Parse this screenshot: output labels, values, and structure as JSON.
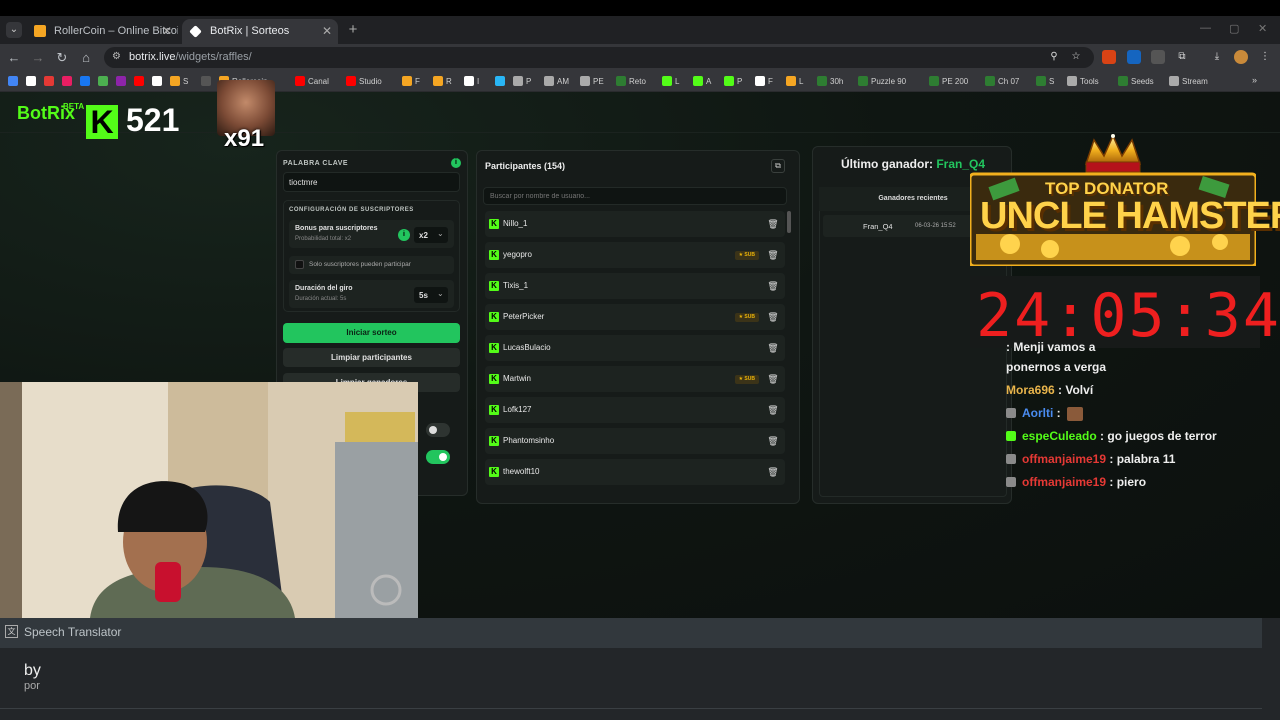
{
  "browser": {
    "tabs": [
      {
        "title": "RollerCoin – Online Bitcoin Mi",
        "active": false,
        "favicon_color": "#f5a623"
      },
      {
        "title": "BotRix | Sorteos",
        "active": true,
        "favicon_color": "#ffffff"
      }
    ],
    "new_tab": "+",
    "url_domain": "botrix.live",
    "url_path": "/widgets/raffles/",
    "bookmarks": [
      {
        "label": "",
        "color": "#4285f4"
      },
      {
        "label": "",
        "color": "#ffffff"
      },
      {
        "label": "",
        "color": "#e53935"
      },
      {
        "label": "",
        "color": "#e91e63"
      },
      {
        "label": "",
        "color": "#1877f2"
      },
      {
        "label": "",
        "color": "#4caf50"
      },
      {
        "label": "",
        "color": "#8e24aa"
      },
      {
        "label": "",
        "color": "#ff0000"
      },
      {
        "label": "",
        "color": "#ffffff"
      },
      {
        "label": "S",
        "color": "#f5a623"
      },
      {
        "label": "",
        "color": "#555555"
      },
      {
        "label": "Rollercoin",
        "color": "#f5a623"
      },
      {
        "label": "Canal",
        "color": "#ff0000"
      },
      {
        "label": "Studio",
        "color": "#ff0000"
      },
      {
        "label": "F",
        "color": "#f5a623"
      },
      {
        "label": "R",
        "color": "#f5a623"
      },
      {
        "label": "I",
        "color": "#ffffff"
      },
      {
        "label": "",
        "color": "#29b6f6"
      },
      {
        "label": "P",
        "color": "#aaaaaa"
      },
      {
        "label": "AM",
        "color": "#aaaaaa"
      },
      {
        "label": "PE",
        "color": "#aaaaaa"
      },
      {
        "label": "Reto",
        "color": "#2e7d32"
      },
      {
        "label": "L",
        "color": "#53fc18"
      },
      {
        "label": "A",
        "color": "#53fc18"
      },
      {
        "label": "P",
        "color": "#53fc18"
      },
      {
        "label": "F",
        "color": "#ffffff"
      },
      {
        "label": "L",
        "color": "#f5a623"
      },
      {
        "label": "30h",
        "color": "#2e7d32"
      },
      {
        "label": "Puzzle 90",
        "color": "#2e7d32"
      },
      {
        "label": "PE 200",
        "color": "#2e7d32"
      },
      {
        "label": "Ch 07",
        "color": "#2e7d32"
      },
      {
        "label": "S",
        "color": "#2e7d32"
      },
      {
        "label": "Tools",
        "color": "#aaaaaa"
      },
      {
        "label": "Seeds",
        "color": "#2e7d32"
      },
      {
        "label": "Stream",
        "color": "#aaaaaa"
      }
    ]
  },
  "overlay": {
    "brand": "BotRix",
    "beta": "BETA",
    "kick_letter": "K",
    "viewer_count": "521",
    "emote_multiplier": "x91"
  },
  "raffle": {
    "keyword_label": "PALABRA CLAVE",
    "keyword_value": "tioctmre",
    "sub_config_label": "CONFIGURACIÓN DE SUSCRIPTORES",
    "sub_bonus_label": "Bonus para suscriptores",
    "sub_bonus_prob": "Probabilidad total: x2",
    "sub_bonus_value": "x2",
    "subs_only_label": "Solo suscriptores pueden participar",
    "spin_label": "Duración del giro",
    "spin_current": "Duración actual: 5s",
    "spin_value": "5s",
    "start_button": "Iniciar sorteo",
    "clear_participants": "Limpiar participantes",
    "clear_winners": "Limpiar ganadores"
  },
  "participants": {
    "title": "Participantes (154)",
    "search_placeholder": "Buscar por nombre de usuario...",
    "sub_badge": "★ SUB",
    "rows": [
      {
        "name": "Nillo_1",
        "sub": false
      },
      {
        "name": "yegopro",
        "sub": true
      },
      {
        "name": "Tixis_1",
        "sub": false
      },
      {
        "name": "PeterPicker",
        "sub": true
      },
      {
        "name": "LucasBulacio",
        "sub": false
      },
      {
        "name": "Martwin",
        "sub": true
      },
      {
        "name": "Lofk127",
        "sub": false
      },
      {
        "name": "Phantomsinho",
        "sub": false
      },
      {
        "name": "thewolft10",
        "sub": false
      }
    ]
  },
  "winners": {
    "last_winner_label": "Último ganador:",
    "last_winner_name": "Fran_Q4",
    "recent_label": "Ganadores recientes",
    "recent": [
      {
        "name": "Fran_Q4",
        "date": "06-03-26 15:52"
      }
    ]
  },
  "stream_overlay": {
    "donator_line1": "TOP DONATOR",
    "donator_line2": "UNCLE HAMSTER",
    "timer": "24:05:34",
    "chat": [
      {
        "user": "",
        "text": ": Menji vamos a",
        "color": "#e53935"
      },
      {
        "user": "",
        "text": "ponernos a verga",
        "color": "#ffffff"
      },
      {
        "user": "Mora696",
        "text": " : Volví",
        "color": "#e8b44b"
      },
      {
        "user": "Aorlti",
        "text": " :",
        "color": "#4a8cf0"
      },
      {
        "user": "espeCuleado",
        "text": " : go juegos de terror",
        "color": "#53fc18"
      },
      {
        "user": "offmanjaime19",
        "text": " : palabra 11",
        "color": "#e53935"
      },
      {
        "user": "offmanjaime19",
        "text": " : piero",
        "color": "#e53935"
      }
    ]
  },
  "translator": {
    "title": "Speech Translator",
    "text": "by",
    "translation": "por"
  }
}
